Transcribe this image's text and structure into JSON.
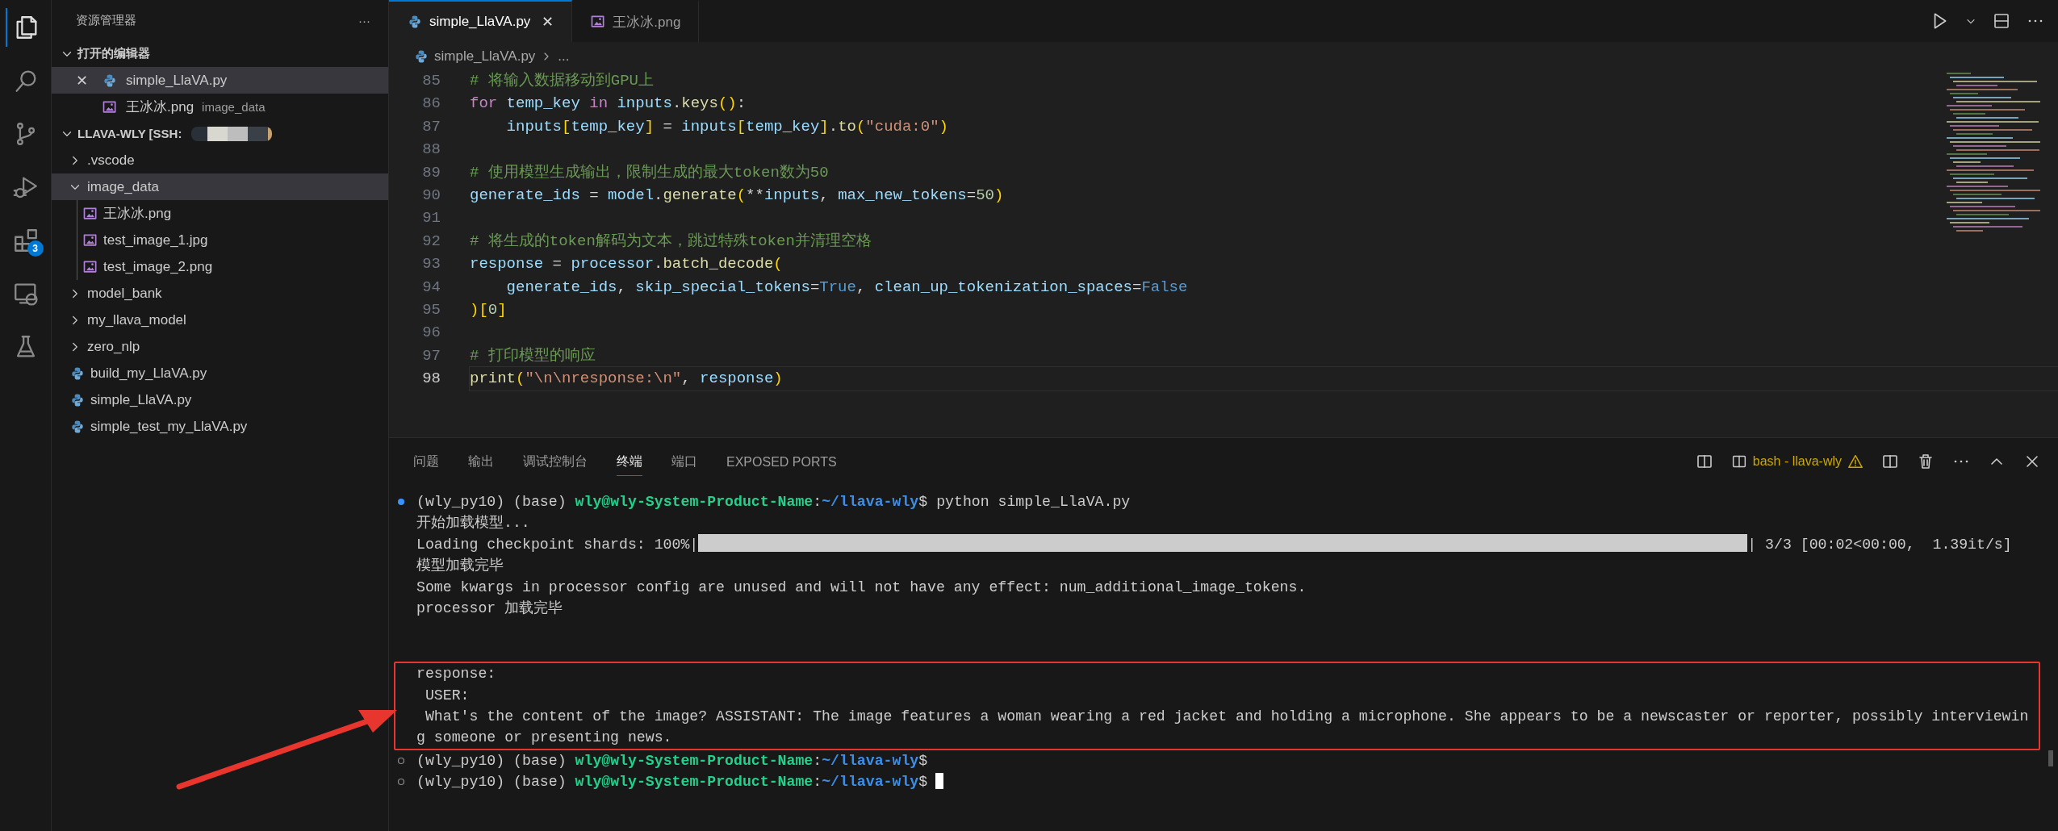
{
  "activity_bar": {
    "items": [
      {
        "kind": "files",
        "selected": true
      },
      {
        "kind": "search",
        "selected": false
      },
      {
        "kind": "source-control",
        "selected": false
      },
      {
        "kind": "run-debug",
        "selected": false
      },
      {
        "kind": "extensions",
        "selected": false,
        "badge": "3"
      },
      {
        "kind": "remote",
        "selected": false
      },
      {
        "kind": "testing",
        "selected": false
      }
    ]
  },
  "sidebar": {
    "title": "资源管理器",
    "more": "···",
    "open_editors": {
      "title": "打开的编辑器",
      "expanded": true,
      "items": [
        {
          "name": "simple_LlaVA.py",
          "kind": "python",
          "selected": true,
          "close": "✕"
        },
        {
          "name": "王冰冰.png",
          "kind": "image",
          "folder": "image_data",
          "selected": false
        }
      ]
    },
    "workspace": {
      "title": "LLAVA-WLY [SSH:",
      "expanded": true,
      "items": [
        {
          "name": ".vscode",
          "kind": "folder",
          "expanded": false,
          "selected": false
        },
        {
          "name": "image_data",
          "kind": "folder",
          "expanded": true,
          "selected": true,
          "children": [
            {
              "name": "王冰冰.png",
              "kind": "image",
              "selected": false
            },
            {
              "name": "test_image_1.jpg",
              "kind": "image",
              "selected": false
            },
            {
              "name": "test_image_2.png",
              "kind": "image",
              "selected": false
            }
          ]
        },
        {
          "name": "model_bank",
          "kind": "folder",
          "expanded": false,
          "selected": false
        },
        {
          "name": "my_llava_model",
          "kind": "folder",
          "expanded": false,
          "selected": false
        },
        {
          "name": "zero_nlp",
          "kind": "folder",
          "expanded": false,
          "selected": false
        },
        {
          "name": "build_my_LlaVA.py",
          "kind": "python",
          "selected": false
        },
        {
          "name": "simple_LlaVA.py",
          "kind": "python",
          "selected": false
        },
        {
          "name": "simple_test_my_LlaVA.py",
          "kind": "python",
          "selected": false
        }
      ]
    }
  },
  "editor": {
    "tabs": [
      {
        "label": "simple_LlaVA.py",
        "kind": "python",
        "selected": true,
        "close": "✕"
      },
      {
        "label": "王冰冰.png",
        "kind": "image",
        "selected": false
      }
    ],
    "breadcrumbs": [
      "simple_LlaVA.py",
      "..."
    ],
    "lines": [
      {
        "number": "85",
        "current": false,
        "tokens": [
          {
            "kind": "comment",
            "text": "# 将输入数据移动到GPU上"
          }
        ]
      },
      {
        "number": "86",
        "current": false,
        "tokens": [
          {
            "kind": "keyword",
            "text": "for "
          },
          {
            "kind": "variable",
            "text": "temp_key "
          },
          {
            "kind": "keyword",
            "text": "in "
          },
          {
            "kind": "variable",
            "text": "inputs"
          },
          {
            "kind": "plain",
            "text": "."
          },
          {
            "kind": "function",
            "text": "keys"
          },
          {
            "kind": "bracket",
            "text": "()"
          },
          {
            "kind": "plain",
            "text": ":"
          }
        ]
      },
      {
        "number": "87",
        "current": false,
        "tokens": [
          {
            "kind": "variable",
            "text": "    inputs"
          },
          {
            "kind": "bracket",
            "text": "["
          },
          {
            "kind": "variable",
            "text": "temp_key"
          },
          {
            "kind": "bracket",
            "text": "]"
          },
          {
            "kind": "plain",
            "text": " = "
          },
          {
            "kind": "variable",
            "text": "inputs"
          },
          {
            "kind": "bracket",
            "text": "["
          },
          {
            "kind": "variable",
            "text": "temp_key"
          },
          {
            "kind": "bracket",
            "text": "]"
          },
          {
            "kind": "plain",
            "text": "."
          },
          {
            "kind": "function",
            "text": "to"
          },
          {
            "kind": "bracket",
            "text": "("
          },
          {
            "kind": "string",
            "text": "\"cuda:0\""
          },
          {
            "kind": "bracket",
            "text": ")"
          }
        ]
      },
      {
        "number": "88",
        "current": false
      },
      {
        "number": "89",
        "current": false,
        "tokens": [
          {
            "kind": "comment",
            "text": "# 使用模型生成输出，限制生成的最大token数为50"
          }
        ]
      },
      {
        "number": "90",
        "current": false,
        "tokens": [
          {
            "kind": "variable",
            "text": "generate_ids"
          },
          {
            "kind": "plain",
            "text": " = "
          },
          {
            "kind": "variable",
            "text": "model"
          },
          {
            "kind": "plain",
            "text": "."
          },
          {
            "kind": "function",
            "text": "generate"
          },
          {
            "kind": "bracket",
            "text": "("
          },
          {
            "kind": "plain",
            "text": "**"
          },
          {
            "kind": "variable",
            "text": "inputs"
          },
          {
            "kind": "plain",
            "text": ", "
          },
          {
            "kind": "variable",
            "text": "max_new_tokens"
          },
          {
            "kind": "plain",
            "text": "="
          },
          {
            "kind": "number",
            "text": "50"
          },
          {
            "kind": "bracket",
            "text": ")"
          }
        ]
      },
      {
        "number": "91",
        "current": false
      },
      {
        "number": "92",
        "current": false,
        "tokens": [
          {
            "kind": "comment",
            "text": "# 将生成的token解码为文本，跳过特殊token并清理空格"
          }
        ]
      },
      {
        "number": "93",
        "current": false,
        "tokens": [
          {
            "kind": "variable",
            "text": "response"
          },
          {
            "kind": "plain",
            "text": " = "
          },
          {
            "kind": "variable",
            "text": "processor"
          },
          {
            "kind": "plain",
            "text": "."
          },
          {
            "kind": "function",
            "text": "batch_decode"
          },
          {
            "kind": "bracket",
            "text": "("
          }
        ]
      },
      {
        "number": "94",
        "current": false,
        "tokens": [
          {
            "kind": "variable",
            "text": "    generate_ids"
          },
          {
            "kind": "plain",
            "text": ", "
          },
          {
            "kind": "variable",
            "text": "skip_special_tokens"
          },
          {
            "kind": "plain",
            "text": "="
          },
          {
            "kind": "constant",
            "text": "True"
          },
          {
            "kind": "plain",
            "text": ", "
          },
          {
            "kind": "variable",
            "text": "clean_up_tokenization_spaces"
          },
          {
            "kind": "plain",
            "text": "="
          },
          {
            "kind": "constant",
            "text": "False"
          }
        ]
      },
      {
        "number": "95",
        "current": false,
        "tokens": [
          {
            "kind": "bracket",
            "text": ")["
          },
          {
            "kind": "number",
            "text": "0"
          },
          {
            "kind": "bracket",
            "text": "]"
          }
        ]
      },
      {
        "number": "96",
        "current": false
      },
      {
        "number": "97",
        "current": false,
        "tokens": [
          {
            "kind": "comment",
            "text": "# 打印模型的响应"
          }
        ]
      },
      {
        "number": "98",
        "current": true,
        "tokens": [
          {
            "kind": "function",
            "text": "print"
          },
          {
            "kind": "bracket",
            "text": "("
          },
          {
            "kind": "string",
            "text": "\"\\n\\nresponse:\\n\""
          },
          {
            "kind": "plain",
            "text": ", "
          },
          {
            "kind": "variable",
            "text": "response"
          },
          {
            "kind": "bracket",
            "text": ")"
          }
        ]
      }
    ]
  },
  "panel": {
    "tabs": [
      {
        "label": "问题",
        "selected": false
      },
      {
        "label": "输出",
        "selected": false
      },
      {
        "label": "调试控制台",
        "selected": false
      },
      {
        "label": "终端",
        "selected": true
      },
      {
        "label": "端口",
        "selected": false
      },
      {
        "label": "EXPOSED PORTS",
        "selected": false
      }
    ],
    "terminal_name": "bash - llava-wly",
    "lines": [
      {
        "kind": "prompt",
        "completed": true,
        "env": "(wly_py10) (base)",
        "user": "wly@wly-System-Product-Name",
        "colon": ":",
        "path": "~/llava-wly",
        "sign": "$",
        "command": "python simple_LlaVA.py",
        "boxed": false
      },
      {
        "kind": "text",
        "text": "开始加载模型...",
        "boxed": false
      },
      {
        "kind": "progress",
        "label": "Loading checkpoint shards: 100%|",
        "level": 1,
        "suffix": "| 3/3 [00:02<00:00,  1.39it/s]",
        "boxed": false
      },
      {
        "kind": "text",
        "text": "模型加载完毕",
        "boxed": false
      },
      {
        "kind": "text",
        "text": "Some kwargs in processor config are unused and will not have any effect: num_additional_image_tokens.",
        "boxed": false
      },
      {
        "kind": "text",
        "text": "processor 加载完毕",
        "boxed": false
      },
      {
        "kind": "blank",
        "boxed": false
      },
      {
        "kind": "blank",
        "boxed": false
      },
      {
        "kind": "text",
        "text": "response:",
        "boxed": true
      },
      {
        "kind": "text",
        "text": " USER:",
        "boxed": true
      },
      {
        "kind": "text",
        "text": " What's the content of the image? ASSISTANT: The image features a woman wearing a red jacket and holding a microphone. She appears to be a newscaster or reporter, possibly interviewin",
        "boxed": true
      },
      {
        "kind": "text",
        "text": "g someone or presenting news.",
        "boxed": true
      },
      {
        "kind": "prompt",
        "completed": false,
        "env": "(wly_py10) (base)",
        "user": "wly@wly-System-Product-Name",
        "colon": ":",
        "path": "~/llava-wly",
        "sign": "$",
        "boxed": false
      },
      {
        "kind": "prompt",
        "completed": false,
        "env": "(wly_py10) (base)",
        "user": "wly@wly-System-Product-Name",
        "colon": ":",
        "path": "~/llava-wly",
        "sign": "$",
        "cursor": true,
        "boxed": false
      }
    ]
  }
}
